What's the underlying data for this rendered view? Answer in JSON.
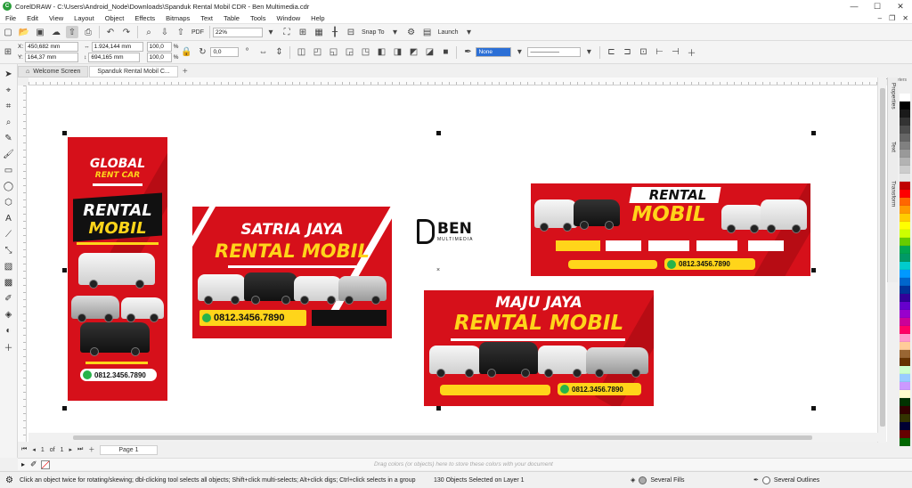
{
  "titlebar": {
    "title": "CorelDRAW - C:\\Users\\Android_Node\\Downloads\\Spanduk Rental Mobil CDR - Ben Multimedia.cdr"
  },
  "menu": [
    "File",
    "Edit",
    "View",
    "Layout",
    "Object",
    "Effects",
    "Bitmaps",
    "Text",
    "Table",
    "Tools",
    "Window",
    "Help"
  ],
  "toolbar": {
    "zoom": "22%",
    "snap_label": "Snap To",
    "launch_label": "Launch",
    "pdf_label": "PDF"
  },
  "properties": {
    "x": "450,682 mm",
    "y": "164,37 mm",
    "w": "1.924,144 mm",
    "h": "694,165 mm",
    "scale_w": "100,0",
    "scale_h": "100,0",
    "pct": "%",
    "angle": "0,0",
    "outline": "None"
  },
  "tabs": [
    "Welcome Screen",
    "Spanduk Rental Mobil C..."
  ],
  "ruler": {
    "unit": "millimeters"
  },
  "dockers": [
    "Properties",
    "Text",
    "Transform"
  ],
  "page_nav": {
    "current": "1",
    "of": "of",
    "total": "1",
    "page_tab": "Page 1"
  },
  "color_dock": {
    "hint": "Drag colors (or objects) here to store these colors with your document"
  },
  "status": {
    "hint": "Click an object twice for rotating/skewing; dbl-clicking tool selects all objects; Shift+click multi-selects; Alt+click digs; Ctrl+click selects in a group",
    "selection": "130 Objects Selected on Layer 1",
    "fill": "Several Fills",
    "outline": "Several Outlines"
  },
  "banners": {
    "global": {
      "title1": "GLOBAL",
      "title2": "RENT CAR",
      "head1": "RENTAL",
      "head2": "MOBIL",
      "phone": "0812.3456.7890"
    },
    "satria": {
      "title1": "SATRIA JAYA",
      "title2": "RENTAL MOBIL",
      "phone": "0812.3456.7890"
    },
    "rental": {
      "head1": "RENTAL",
      "head2": "MOBIL",
      "phone": "0812.3456.7890"
    },
    "maju": {
      "title1": "MAJU JAYA",
      "title2": "RENTAL MOBIL",
      "phone": "0812.3456.7890"
    }
  },
  "logo": {
    "name": "BEN",
    "sub": "MULTIMEDIA"
  },
  "palette": [
    "#ffffff",
    "#000000",
    "#1a1a1a",
    "#333333",
    "#4d4d4d",
    "#666666",
    "#808080",
    "#999999",
    "#b3b3b3",
    "#cccccc",
    "#e6e6e6",
    "#c00000",
    "#ff0000",
    "#ff6600",
    "#ff9900",
    "#ffcc00",
    "#ffff00",
    "#ccff00",
    "#66cc00",
    "#00a651",
    "#009966",
    "#00cccc",
    "#0099ff",
    "#0066cc",
    "#003399",
    "#330099",
    "#6600cc",
    "#9900cc",
    "#cc0099",
    "#ff0066",
    "#ff99cc",
    "#ffcc99",
    "#996633",
    "#663300",
    "#ccffcc",
    "#99ccff",
    "#cc99ff",
    "#ffffcc",
    "#003300",
    "#330000",
    "#333300",
    "#000033",
    "#660000",
    "#006600"
  ]
}
